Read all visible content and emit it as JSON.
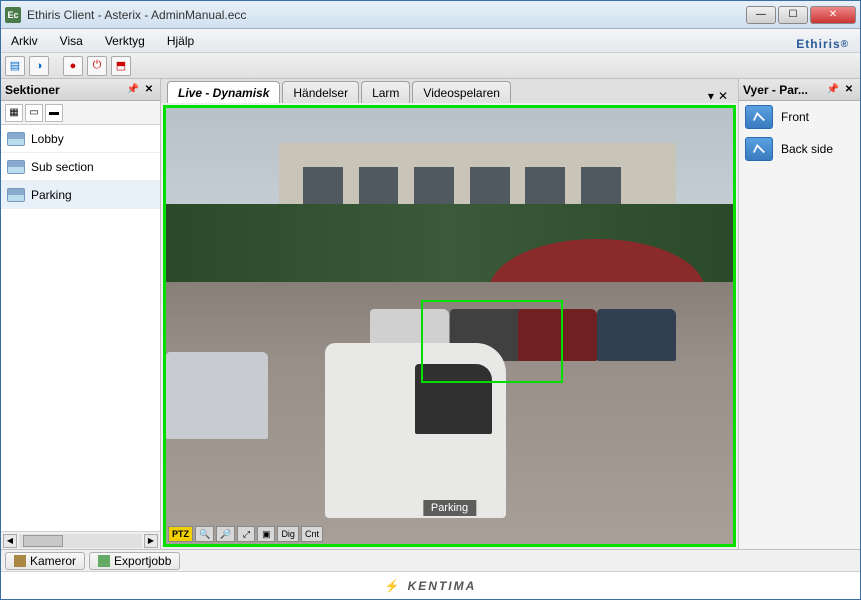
{
  "window": {
    "title": "Ethiris Client - Asterix - AdminManual.ecc",
    "app_icon": "Ec"
  },
  "menu": {
    "arkiv": "Arkiv",
    "visa": "Visa",
    "verktyg": "Verktyg",
    "hjalp": "Hjälp"
  },
  "brand": {
    "name": "Ethiris",
    "reg": "®"
  },
  "panels": {
    "left_title": "Sektioner",
    "right_title": "Vyer - Par...",
    "sections": [
      "Lobby",
      "Sub section",
      "Parking"
    ],
    "views": [
      "Front",
      "Back side"
    ]
  },
  "tabs": {
    "live": "Live - Dynamisk",
    "handelser": "Händelser",
    "larm": "Larm",
    "video": "Videospelaren"
  },
  "camera": {
    "label": "Parking",
    "ptz": "PTZ",
    "dig": "Dig",
    "cnt": "Cnt"
  },
  "bottom": {
    "kameror": "Kameror",
    "export": "Exportjobb"
  },
  "footer": {
    "company": "KENTIMA"
  }
}
